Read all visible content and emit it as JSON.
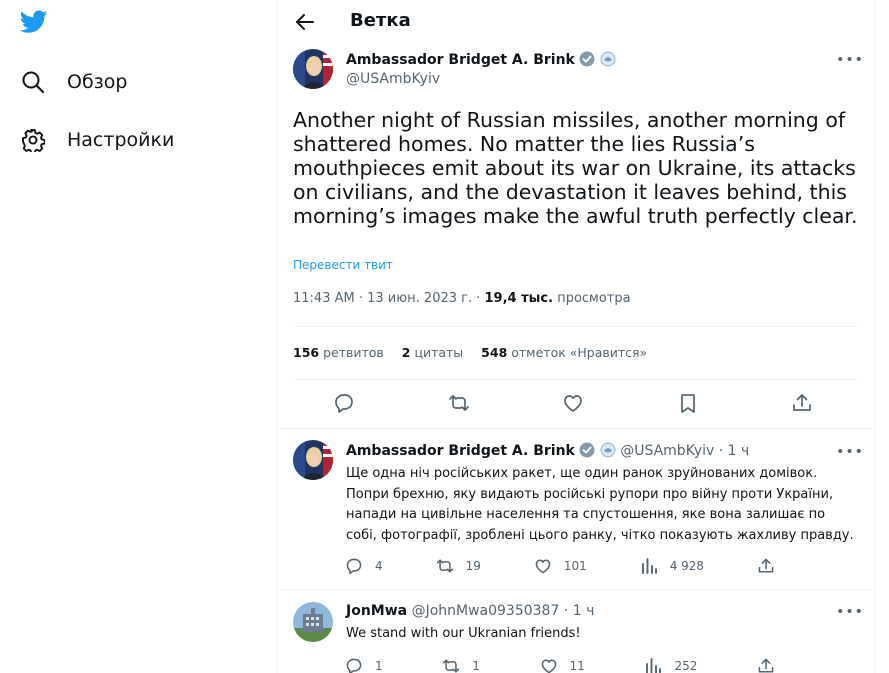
{
  "sidebar": {
    "logo": "twitter-bird-icon",
    "items": [
      {
        "label": "Обзор",
        "icon": "search-icon"
      },
      {
        "label": "Настройки",
        "icon": "gear-icon"
      }
    ]
  },
  "header": {
    "title": "Ветка",
    "back_icon": "arrow-left-icon"
  },
  "main_tweet": {
    "author_name": "Ambassador Bridget A. Brink",
    "author_handle": "@USAmbKyiv",
    "text": "Another night of Russian missiles, another morning of shattered homes. No matter the lies Russia’s mouthpieces emit about its war on Ukraine, its attacks on civilians, and the devastation it leaves behind, this morning’s images make the awful truth perfectly clear.",
    "translate_label": "Перевести твит",
    "time": "11:43 AM · 13 июн. 2023 г. · ",
    "views_count": "19,4 тыс.",
    "views_label": " просмотра",
    "stats": {
      "retweets_count": "156",
      "retweets_label": " ретвитов",
      "quotes_count": "2",
      "quotes_label": " цитаты",
      "likes_count": "548",
      "likes_label": " отметок «Нравится»"
    }
  },
  "replies": [
    {
      "author_name": "Ambassador Bridget A. Brink",
      "author_handle": "@USAmbKyiv",
      "time": " · 1 ч",
      "text": "Ще одна ніч російських ракет, ще один ранок зруйнованих домівок. Попри брехню, яку видають російські рупори про війну проти України, напади на цивільне населення та спустошення, яке вона залишає по собі, фотографії, зроблені цього ранку, чітко показують жахливу правду.",
      "replies": "4",
      "retweets": "19",
      "likes": "101",
      "views": "4 928"
    },
    {
      "author_name": "JonMwa",
      "author_handle": "@JohnMwa09350387",
      "time": " · 1 ч",
      "text": "We stand with our Ukranian friends!",
      "replies": "1",
      "retweets": "1",
      "likes": "11",
      "views": "252"
    }
  ],
  "colors": {
    "accent": "#1d9bf0",
    "text_primary": "#0f1419",
    "text_secondary": "#536471",
    "divider": "#eff3f4"
  }
}
